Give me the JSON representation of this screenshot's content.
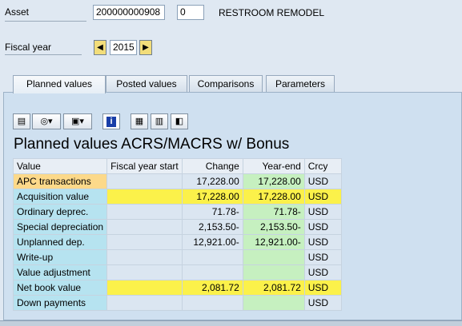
{
  "header": {
    "asset_label": "Asset",
    "asset_number": "200000000908",
    "sub_number": "0",
    "asset_description": "RESTROOM REMODEL",
    "fiscal_year_label": "Fiscal year",
    "fiscal_year": "2015"
  },
  "tabs": [
    {
      "label": "Planned values",
      "active": true
    },
    {
      "label": "Posted values",
      "active": false
    },
    {
      "label": "Comparisons",
      "active": false
    },
    {
      "label": "Parameters",
      "active": false
    }
  ],
  "toolbar": {
    "icons": [
      "print-icon",
      "view-icon",
      "export-icon",
      "info-icon",
      "layout-icon",
      "calculator-icon",
      "display-icon"
    ]
  },
  "section_title": "Planned values ACRS/MACRS w/ Bonus",
  "table": {
    "headers": [
      "Value",
      "Fiscal year start",
      "Change",
      "Year-end",
      "Crcy"
    ],
    "rows": [
      {
        "value": "APC transactions",
        "fy_start": "",
        "change": "17,228.00",
        "year_end": "17,228.00",
        "crcy": "USD"
      },
      {
        "value": "Acquisition value",
        "fy_start": "",
        "change": "17,228.00",
        "year_end": "17,228.00",
        "crcy": "USD"
      },
      {
        "value": "Ordinary deprec.",
        "fy_start": "",
        "change": "71.78-",
        "year_end": "71.78-",
        "crcy": "USD"
      },
      {
        "value": "Special depreciation",
        "fy_start": "",
        "change": "2,153.50-",
        "year_end": "2,153.50-",
        "crcy": "USD"
      },
      {
        "value": "Unplanned dep.",
        "fy_start": "",
        "change": "12,921.00-",
        "year_end": "12,921.00-",
        "crcy": "USD"
      },
      {
        "value": "Write-up",
        "fy_start": "",
        "change": "",
        "year_end": "",
        "crcy": "USD"
      },
      {
        "value": "Value adjustment",
        "fy_start": "",
        "change": "",
        "year_end": "",
        "crcy": "USD"
      },
      {
        "value": "Net book value",
        "fy_start": "",
        "change": "2,081.72",
        "year_end": "2,081.72",
        "crcy": "USD"
      },
      {
        "value": "Down payments",
        "fy_start": "",
        "change": "",
        "year_end": "",
        "crcy": "USD"
      }
    ]
  }
}
